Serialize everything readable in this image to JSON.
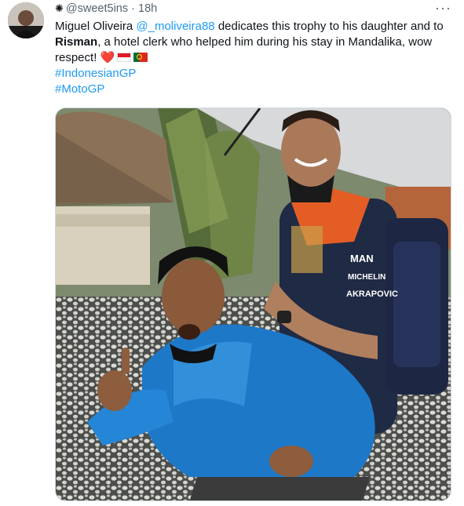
{
  "tweet": {
    "badge_icon": "sun-badge-icon",
    "handle": "@sweet5ins",
    "separator": "·",
    "time": "18h",
    "more_label": "···",
    "text": {
      "part1": "Miguel Oliveira ",
      "mention": "@_moliveira88",
      "part2": " dedicates this trophy to his daughter and to ",
      "bold_name": "Risman",
      "part3": ", a hotel clerk who helped him during his stay in Mandalika, wow respect! ",
      "heart": "❤️",
      "flag1": "indonesia-flag-icon",
      "flag2": "portugal-flag-icon"
    },
    "hashtags": [
      "#IndonesianGP",
      "#MotoGP"
    ],
    "image": {
      "jersey_text": [
        "MAN",
        "MICHELIN",
        "AKRAPOVIC"
      ]
    },
    "colors": {
      "link": "#1d9bf0",
      "text": "#0f1419",
      "muted": "#536471"
    }
  }
}
